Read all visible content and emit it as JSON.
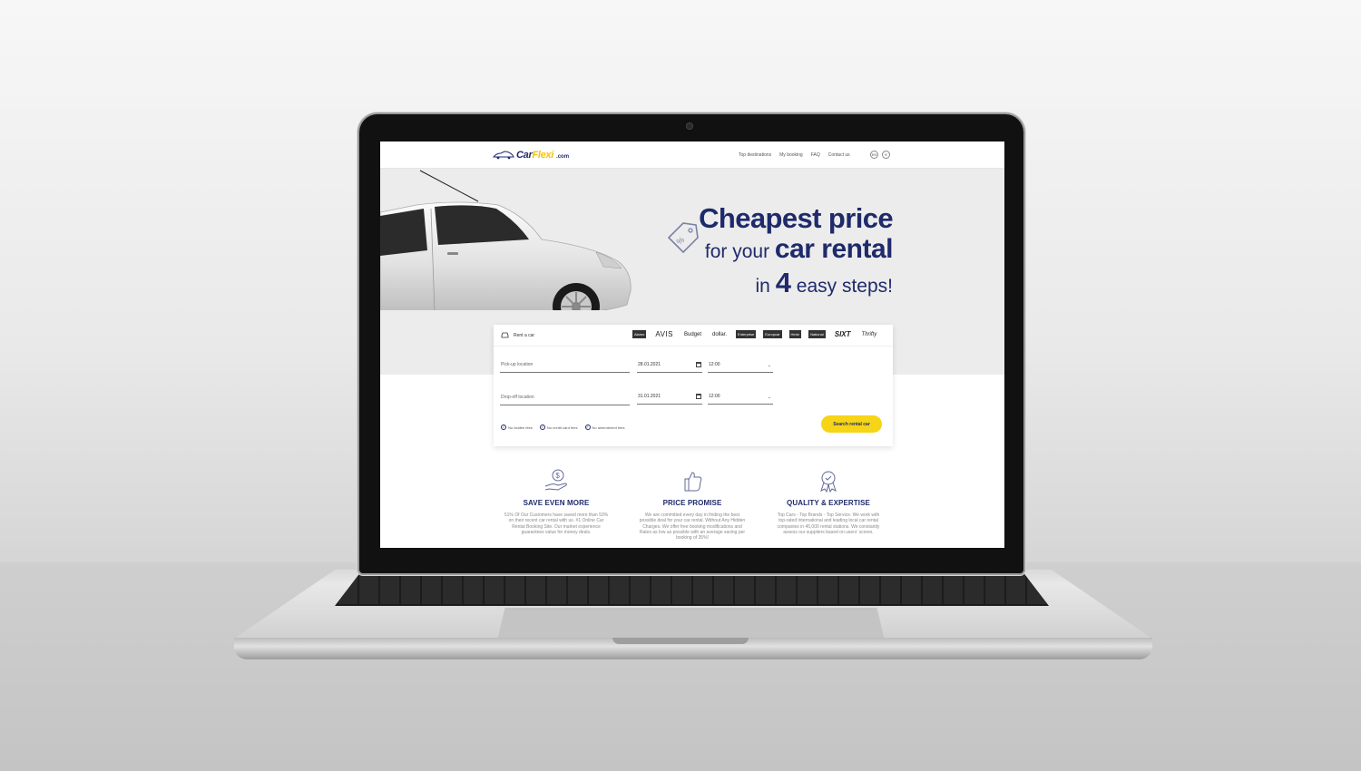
{
  "site": {
    "logo": {
      "name_part1": "Car",
      "name_part2": "Flexi",
      "domain": ".com"
    },
    "nav": [
      "Top destinations",
      "My booking",
      "FAQ",
      "Contact us"
    ],
    "lang": {
      "language": "EN",
      "currency": "€"
    }
  },
  "hero": {
    "line1": "Cheapest price",
    "line2_prefix": "for your ",
    "line2_bold": "car rental",
    "line3_prefix": "in ",
    "line3_bold": "4",
    "line3_suffix": " easy steps!"
  },
  "search": {
    "tab_label": "Rent a car",
    "brands": [
      "Alamo",
      "AVIS",
      "Budget",
      "dollar.",
      "Enterprise",
      "Europcar",
      "Hertz",
      "National",
      "SIXT",
      "Thrifty"
    ],
    "pickup": {
      "placeholder": "Pick-up location",
      "date": "28.01.2021",
      "time": "12:00"
    },
    "dropoff": {
      "placeholder": "Drop-off location",
      "date": "31.01.2021",
      "time": "12:00"
    },
    "badges": [
      "No hidden fees",
      "No credit card fees",
      "No amendment fees"
    ],
    "button_label": "Search rental car"
  },
  "features": [
    {
      "title": "SAVE EVEN MORE",
      "icon": "money-hand-icon",
      "desc": "51% Of Our Customers have saved more than 53% on their recent car rental with us. #1 Online Car Rental Booking Site. Our market experience guarantees value for money deals."
    },
    {
      "title": "PRICE PROMISE",
      "icon": "thumbs-up-icon",
      "desc": "We are committed every day in finding the best possible deal for your car rental. Without Any Hidden Charges. We offer free booking modifications and Rates as low as possible with an average saving per booking of 35%!"
    },
    {
      "title": "QUALITY & EXPERTISE",
      "icon": "award-badge-icon",
      "desc": "Top Cars - Top Brands - Top Service. We work with top-rated international and leading local car rental companies in 45,000 rental stations. We constantly assess our suppliers based on users' scores."
    }
  ],
  "colors": {
    "brand_navy": "#1f2a6b",
    "brand_yellow": "#f6d417",
    "hero_bg": "#ececec"
  }
}
